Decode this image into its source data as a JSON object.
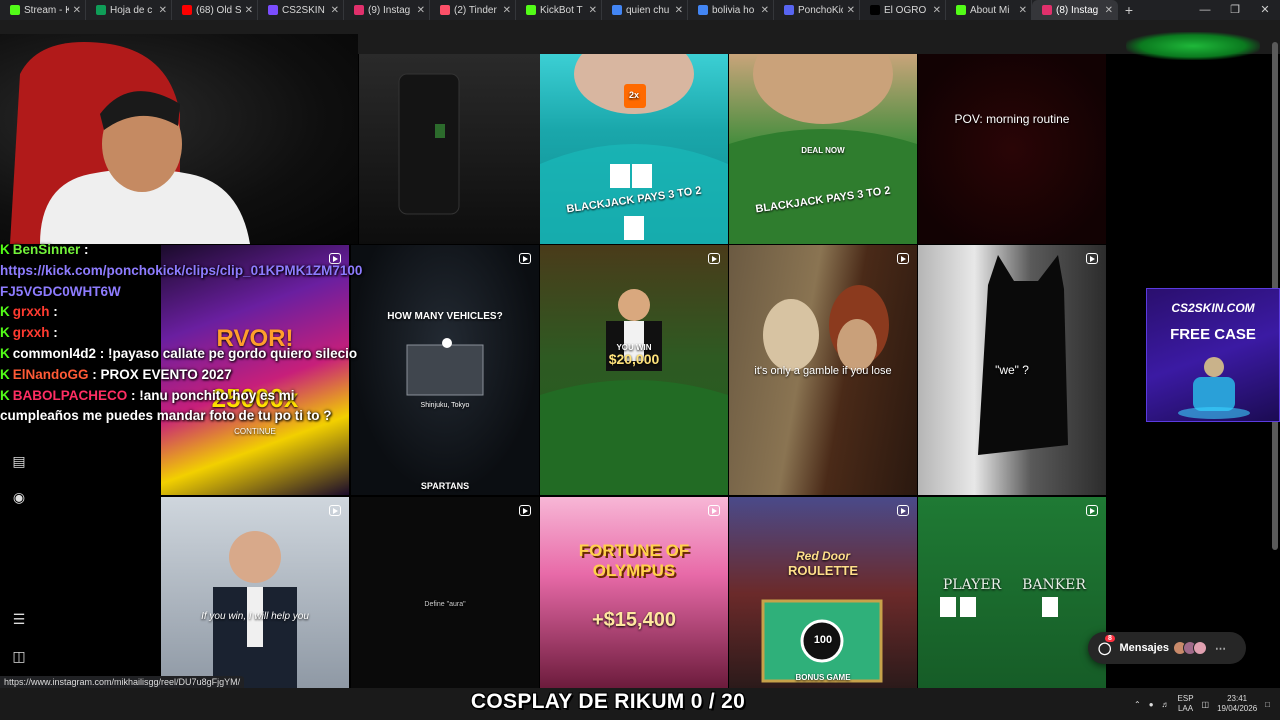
{
  "browser": {
    "tabs": [
      {
        "label": "Stream - K",
        "color": "#53fc18"
      },
      {
        "label": "Hoja de c",
        "color": "#0f9d58"
      },
      {
        "label": "(68) Old S",
        "color": "#ff0000"
      },
      {
        "label": "CS2SKIN",
        "color": "#7b4dff"
      },
      {
        "label": "(9) Instag",
        "color": "#e1306c"
      },
      {
        "label": "(2) Tinder",
        "color": "#fd5068"
      },
      {
        "label": "KickBot T",
        "color": "#53fc18"
      },
      {
        "label": "quien chu",
        "color": "#4285f4"
      },
      {
        "label": "bolivia ho",
        "color": "#4285f4"
      },
      {
        "label": "PonchoKic",
        "color": "#5865f2"
      },
      {
        "label": "El OGRO",
        "color": "#000000"
      },
      {
        "label": "About Mi",
        "color": "#53fc18"
      },
      {
        "label": "(8) Instag",
        "color": "#e1306c"
      }
    ],
    "new_tab": "+",
    "status_url": "https://www.instagram.com/mikhailisgg/reel/DU7u8gFjgYM/"
  },
  "grid": {
    "tiles": [
      {
        "caption": ""
      },
      {
        "caption": ""
      },
      {
        "caption": ""
      },
      {
        "caption": "POV: morning routine"
      },
      {
        "caption": ""
      },
      {
        "caption": "HOW MANY VEHICLES?"
      },
      {
        "caption": "$20,000"
      },
      {
        "caption": "it's only a gamble if you lose"
      },
      {
        "caption": "\"we\" ?"
      },
      {
        "caption": "If you win, I will help you"
      },
      {
        "caption": "Define \"aura\""
      },
      {
        "caption": "+$15,400"
      },
      {
        "caption": "ROULETTE"
      },
      {
        "caption": "PLAYER"
      }
    ],
    "tile_texts": {
      "deal_now": "DEAL NOW",
      "you_win": "YOU WIN",
      "blackjack": "BLACKJACK PAYS 3 TO 2",
      "bet_label": "2x",
      "shinjuku": "Shinjuku, Tokyo",
      "fortune": "FORTUNE OF OLYMPUS",
      "red_door": "Red Door",
      "bonus_game": "BONUS GAME",
      "hundred": "100",
      "spartans": "SPARTANS",
      "banker": "BANKER",
      "rvor": "RVOR!",
      "multiplier": "25000x",
      "continue": "CONTINUE"
    }
  },
  "chat": [
    {
      "user": "BenSinner",
      "user_color": "#73f23a",
      "sep": " :",
      "message": ""
    },
    {
      "user": "",
      "user_color": "#ffffff",
      "sep": "",
      "message": "https://kick.com/ponchokick/clips/clip_01KPMK1ZM7100"
    },
    {
      "user": "",
      "user_color": "#ffffff",
      "sep": "",
      "message": "FJ5VGDC0WHT6W"
    },
    {
      "user": "grxxh",
      "user_color": "#ff3b30",
      "sep": " :",
      "message": ""
    },
    {
      "user": "grxxh",
      "user_color": "#ff3b30",
      "sep": " :",
      "message": ""
    },
    {
      "user": "commonl4d2",
      "user_color": "#ffffff",
      "sep": " :",
      "message": " !payaso callate pe gordo quiero silecio"
    },
    {
      "user": "ElNandoGG",
      "user_color": "#ff5a36",
      "sep": " :",
      "message": " PROX EVENTO 2027"
    },
    {
      "user": "BABOLPACHECO",
      "user_color": "#ff2e63",
      "sep": " :",
      "message": " !anu ponchito hoy es mi"
    },
    {
      "user": "",
      "user_color": "#ffffff",
      "sep": "",
      "message": "cumpleaños me puedes mandar foto de tu po ti to ?"
    }
  ],
  "ad": {
    "brand": "CS2SKIN.COM",
    "cta": "FREE CASE"
  },
  "messages": {
    "label": "Mensajes",
    "badge": "8"
  },
  "overlay_banner": "COSPLAY DE RIKUM 0 / 20",
  "tray": {
    "lang_top": "ESP",
    "lang_bottom": "LAA",
    "time": "23:41",
    "date": "19/04/2026"
  },
  "colors": {
    "kick_green": "#53fc18",
    "link_purple": "#8e7cff"
  }
}
